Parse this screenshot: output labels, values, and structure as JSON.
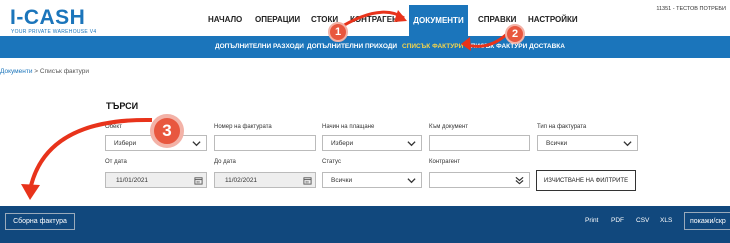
{
  "app": {
    "logo_text": "I-CASH",
    "logo_sub": "YOUR PRIVATE WAREHOUSE V4",
    "user_info": "11351 - ТЕСТОВ ПОТРЕБИ"
  },
  "nav": {
    "items": [
      "НАЧАЛО",
      "ОПЕРАЦИИ",
      "СТОКИ",
      "КОНТРАГЕН"
    ],
    "active": "ДОКУМЕНТИ",
    "after": [
      "СПРАВКИ",
      "НАСТРОЙКИ"
    ]
  },
  "subnav": {
    "items": [
      "ДОПЪЛНИТЕЛНИ РАЗХОДИ",
      "ДОПЪЛНИТЕЛНИ ПРИХОДИ",
      "СПИСЪК ФАКТУРИ",
      "СПИСЪК ФАКТУРИ ДОСТАВКА"
    ],
    "active_index": 2
  },
  "breadcrumb": {
    "link": "Документи",
    "separator": " > ",
    "current": "Списък фактури"
  },
  "search": {
    "title": "ТЪРСИ",
    "object_label": "Обект",
    "object_value": "Избери",
    "invoice_no_label": "Номер на фактурата",
    "payment_label": "Начин на плащане",
    "payment_value": "Избери",
    "to_doc_label": "Към документ",
    "invoice_type_label": "Тип на фактурата",
    "invoice_type_value": "Всички",
    "date_from_label": "От дата",
    "date_from_value": "11/01/2021",
    "date_to_label": "До дата",
    "date_to_value": "11/02/2021",
    "status_label": "Статус",
    "status_value": "Всички",
    "contractor_label": "Контрагент",
    "clear_button": "ИЗЧИСТВАНЕ НА ФИЛТРИТЕ"
  },
  "footer": {
    "summary_button": "Сборна фактура",
    "exports": [
      "Print",
      "PDF",
      "CSV",
      "XLS"
    ],
    "show_hide": "покажи/скр"
  },
  "annotations": {
    "badge1": "1",
    "badge2": "2",
    "badge3": "3"
  },
  "colors": {
    "primary": "#1b75bb",
    "dark": "#11487d",
    "accent": "#e8573f",
    "active_sub": "#f6d54a"
  }
}
